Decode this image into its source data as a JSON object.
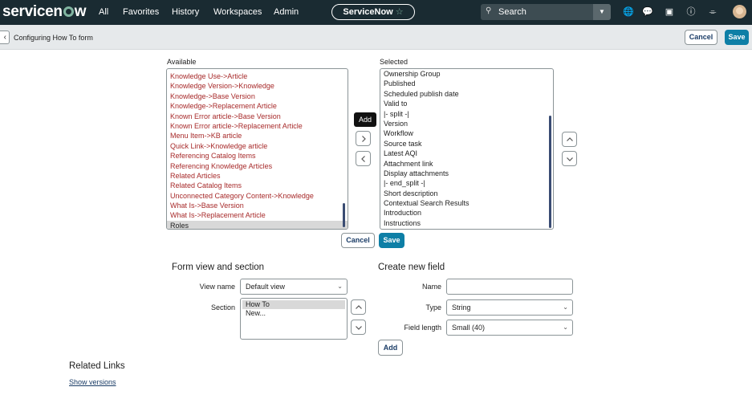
{
  "nav": {
    "brand": "servicenow",
    "links": [
      "All",
      "Favorites",
      "History",
      "Workspaces",
      "Admin"
    ],
    "context": "ServiceNow",
    "search_label": "Search"
  },
  "header": {
    "title": "Configuring How To form",
    "cancel_label": "Cancel",
    "save_label": "Save"
  },
  "slushbucket": {
    "available_label": "Available",
    "selected_label": "Selected",
    "available_items": [
      "Knowledge Use->Article",
      "Knowledge Version->Knowledge",
      "Knowledge->Base Version",
      "Knowledge->Replacement Article",
      "Known Error article->Base Version",
      "Known Error article->Replacement Article",
      "Menu Item->KB article",
      "Quick Link->Knowledge article",
      "Referencing Catalog Items",
      "Referencing Knowledge Articles",
      "Related Articles",
      "Related Catalog Items",
      "Unconnected Category Content->Knowledge",
      "What Is->Base Version",
      "What Is->Replacement Article",
      "Roles"
    ],
    "selected_items": [
      "Ownership Group",
      "Published",
      "Scheduled publish date",
      "Valid to",
      "|- split -|",
      "Version",
      "Workflow",
      "Source task",
      "Latest AQI",
      "Attachment link",
      "Display attachments",
      "|- end_split -|",
      "Short description",
      "Contextual Search Results",
      "Introduction",
      "Instructions"
    ],
    "add_tooltip": "Add",
    "cancel_label": "Cancel",
    "save_label": "Save"
  },
  "form_view": {
    "heading": "Form view and section",
    "view_name_label": "View name",
    "view_name_value": "Default view",
    "section_label": "Section",
    "sections": [
      "How To",
      "New..."
    ]
  },
  "new_field": {
    "heading": "Create new field",
    "name_label": "Name",
    "type_label": "Type",
    "type_value": "String",
    "length_label": "Field length",
    "length_value": "Small (40)",
    "add_label": "Add"
  },
  "related": {
    "heading": "Related Links",
    "link": "Show versions"
  },
  "colors": {
    "nav_bg": "#1a2b32",
    "accent": "#81b5a1",
    "primary_button": "#0e7fa6",
    "available_text": "#a72a2a"
  }
}
